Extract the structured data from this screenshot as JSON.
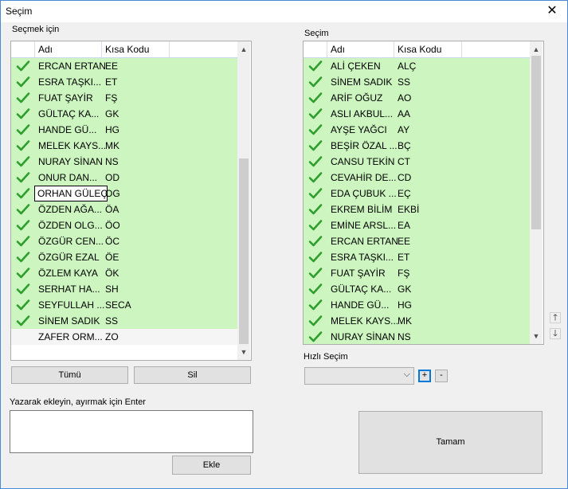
{
  "window": {
    "title": "Seçim",
    "close_glyph": "✕"
  },
  "left": {
    "label": "Seçmek için",
    "columns": [
      "Adı",
      "Kısa Kodu"
    ],
    "rows": [
      {
        "name": "ERCAN ERTAN",
        "code": "EE",
        "checked": true
      },
      {
        "name": "ESRA TAŞKI...",
        "code": "ET",
        "checked": true
      },
      {
        "name": "FUAT ŞAYİR",
        "code": "FŞ",
        "checked": true
      },
      {
        "name": "GÜLTAÇ KA...",
        "code": "GK",
        "checked": true
      },
      {
        "name": "HANDE GÜ...",
        "code": "HG",
        "checked": true
      },
      {
        "name": "MELEK KAYS...",
        "code": "MK",
        "checked": true
      },
      {
        "name": "NURAY SİNAN",
        "code": "NS",
        "checked": true
      },
      {
        "name": "ONUR DAN...",
        "code": "OD",
        "checked": true
      },
      {
        "name": "ORHAN GÜLEÇ",
        "code": "OG",
        "checked": true,
        "focused": true
      },
      {
        "name": "ÖZDEN AĞA...",
        "code": "ÖA",
        "checked": true
      },
      {
        "name": "ÖZDEN OLG...",
        "code": "ÖO",
        "checked": true
      },
      {
        "name": "ÖZGÜR CEN...",
        "code": "ÖC",
        "checked": true
      },
      {
        "name": "ÖZGÜR EZAL",
        "code": "ÖE",
        "checked": true
      },
      {
        "name": "ÖZLEM KAYA",
        "code": "ÖK",
        "checked": true
      },
      {
        "name": "SERHAT HA...",
        "code": "SH",
        "checked": true
      },
      {
        "name": "SEYFULLAH ...",
        "code": "SECA",
        "checked": true
      },
      {
        "name": "SİNEM SADIK",
        "code": "SS",
        "checked": true
      },
      {
        "name": "ZAFER ORM...",
        "code": "ZO",
        "checked": false
      }
    ],
    "all_button": "Tümü",
    "clear_button": "Sil"
  },
  "right": {
    "label": "Seçim",
    "columns": [
      "Adı",
      "Kısa Kodu"
    ],
    "rows": [
      {
        "name": "ALİ ÇEKEN",
        "code": "ALÇ"
      },
      {
        "name": "SİNEM SADIK",
        "code": "SS"
      },
      {
        "name": "ARİF OĞUZ",
        "code": "AO"
      },
      {
        "name": "ASLI AKBUL...",
        "code": "AA"
      },
      {
        "name": "AYŞE YAĞCI",
        "code": "AY"
      },
      {
        "name": "BEŞİR ÖZAL ...",
        "code": "BÇ"
      },
      {
        "name": "CANSU TEKİN",
        "code": "CT"
      },
      {
        "name": "CEVAHİR DE...",
        "code": "CD"
      },
      {
        "name": "EDA ÇUBUK ...",
        "code": "EÇ"
      },
      {
        "name": "EKREM BİLİM",
        "code": "EKBİ"
      },
      {
        "name": "EMİNE ARSL...",
        "code": "EA"
      },
      {
        "name": "ERCAN ERTAN",
        "code": "EE"
      },
      {
        "name": "ESRA TAŞKI...",
        "code": "ET"
      },
      {
        "name": "FUAT ŞAYİR",
        "code": "FŞ"
      },
      {
        "name": "GÜLTAÇ KA...",
        "code": "GK"
      },
      {
        "name": "HANDE GÜ...",
        "code": "HG"
      },
      {
        "name": "MELEK KAYS...",
        "code": "MK"
      },
      {
        "name": "NURAY SİNAN",
        "code": "NS"
      }
    ],
    "move_up": "🡑",
    "move_down": "🡓"
  },
  "quick": {
    "label": "Hızlı Seçim",
    "value": "",
    "add": "+",
    "remove": "-"
  },
  "entry": {
    "label": "Yazarak ekleyin, ayırmak için Enter",
    "value": "",
    "add_button": "Ekle"
  },
  "ok_button": "Tamam",
  "colors": {
    "selected_row": "#ccf5bf",
    "check": "#2e9e2e",
    "accent": "#0078d7"
  }
}
